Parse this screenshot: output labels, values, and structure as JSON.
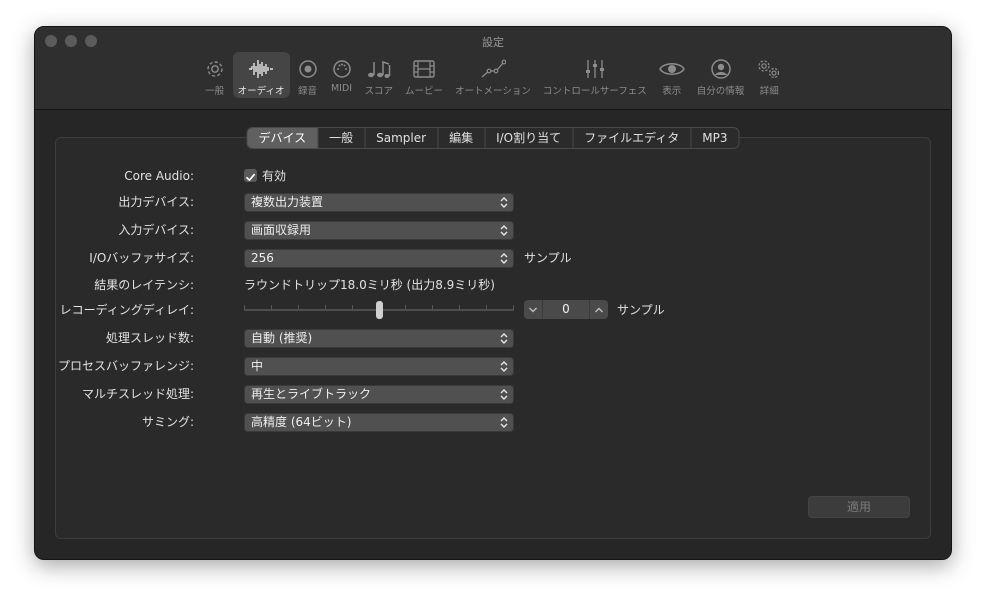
{
  "window": {
    "title": "設定"
  },
  "toolbar": {
    "items": [
      {
        "label": "一般",
        "icon": "gear-icon"
      },
      {
        "label": "オーディオ",
        "icon": "waveform-icon",
        "active": true
      },
      {
        "label": "録音",
        "icon": "record-icon"
      },
      {
        "label": "MIDI",
        "icon": "midi-port-icon"
      },
      {
        "label": "スコア",
        "icon": "music-notes-icon"
      },
      {
        "label": "ムービー",
        "icon": "film-icon"
      },
      {
        "label": "オートメーション",
        "icon": "automation-curve-icon"
      },
      {
        "label": "コントロールサーフェス",
        "icon": "faders-icon"
      },
      {
        "label": "表示",
        "icon": "eye-icon"
      },
      {
        "label": "自分の情報",
        "icon": "person-icon"
      },
      {
        "label": "詳細",
        "icon": "gears-icon"
      }
    ]
  },
  "tabs": [
    {
      "label": "デバイス",
      "active": true
    },
    {
      "label": "一般"
    },
    {
      "label": "Sampler"
    },
    {
      "label": "編集"
    },
    {
      "label": "I/O割り当て"
    },
    {
      "label": "ファイルエディタ"
    },
    {
      "label": "MP3"
    }
  ],
  "form": {
    "core_audio": {
      "label": "Core Audio:",
      "checkbox_label": "有効",
      "checked": true
    },
    "output_device": {
      "label": "出力デバイス:",
      "value": "複数出力装置"
    },
    "input_device": {
      "label": "入力デバイス:",
      "value": "画面収録用"
    },
    "io_buffer": {
      "label": "I/Oバッファサイズ:",
      "value": "256",
      "suffix": "サンプル"
    },
    "latency": {
      "label": "結果のレイテンシ:",
      "value": "ラウンドトリップ18.0ミリ秒 (出力8.9ミリ秒)"
    },
    "recording_delay": {
      "label": "レコーディングディレイ:",
      "value": "0",
      "suffix": "サンプル",
      "slider_fraction": 0.5
    },
    "threads": {
      "label": "処理スレッド数:",
      "value": "自動 (推奨)"
    },
    "process_buffer": {
      "label": "プロセスバッファレンジ:",
      "value": "中"
    },
    "multithread": {
      "label": "マルチスレッド処理:",
      "value": "再生とライブトラック"
    },
    "summing": {
      "label": "サミング:",
      "value": "高精度 (64ビット)"
    }
  },
  "apply_button": {
    "label": "適用"
  }
}
